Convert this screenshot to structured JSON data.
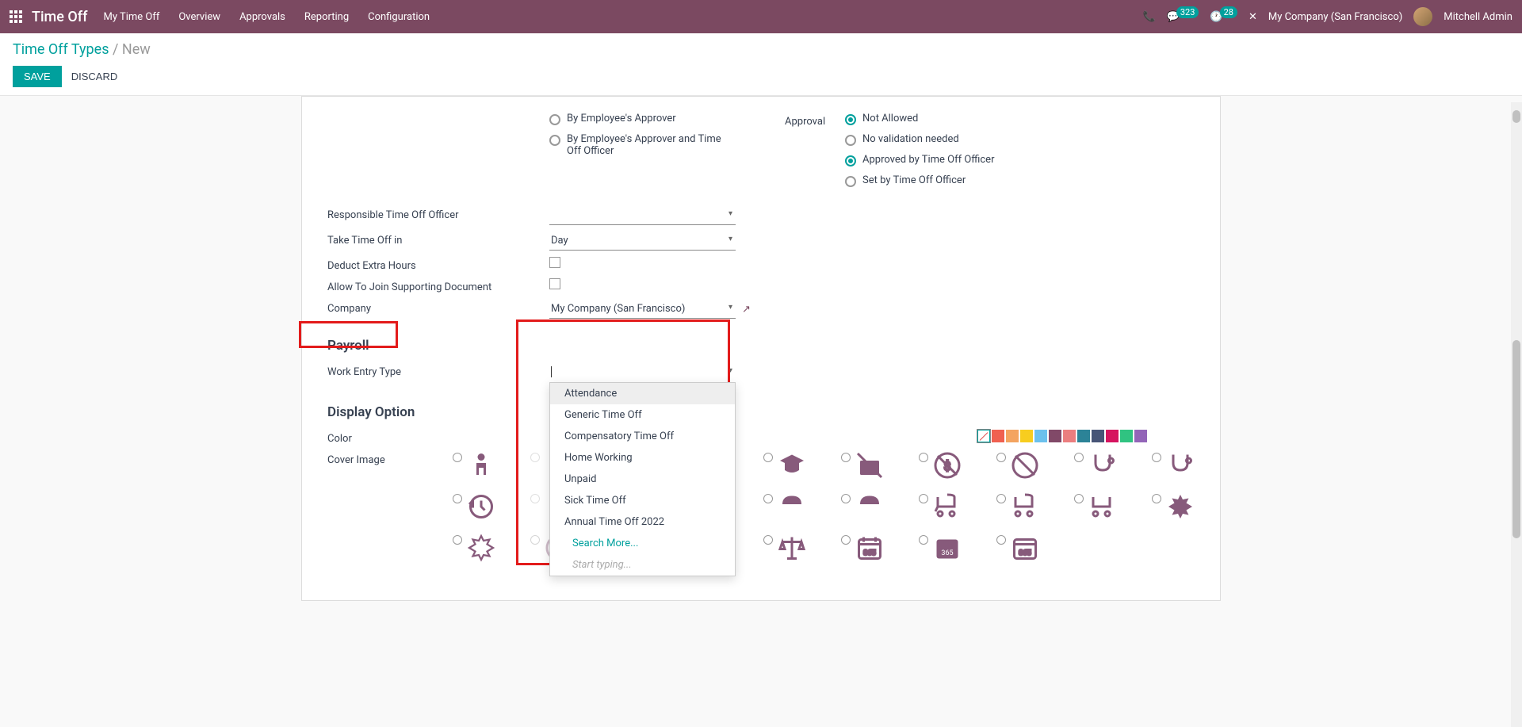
{
  "nav": {
    "app_title": "Time Off",
    "items": [
      "My Time Off",
      "Overview",
      "Approvals",
      "Reporting",
      "Configuration"
    ],
    "msg_count": "323",
    "activity_count": "28",
    "company": "My Company (San Francisco)",
    "user": "Mitchell Admin"
  },
  "breadcrumb": {
    "parent": "Time Off Types",
    "current": "New"
  },
  "actions": {
    "save": "SAVE",
    "discard": "DISCARD"
  },
  "form": {
    "left_radios": {
      "options": [
        "By Employee's Approver",
        "By Employee's Approver and Time Off Officer"
      ]
    },
    "approval": {
      "label": "Approval",
      "options": [
        "Not Allowed",
        "No validation needed",
        "Approved by Time Off Officer",
        "Set by Time Off Officer"
      ],
      "checked": [
        0,
        2
      ]
    },
    "responsible_label": "Responsible Time Off Officer",
    "take_label": "Take Time Off in",
    "take_value": "Day",
    "deduct_label": "Deduct Extra Hours",
    "supporting_label": "Allow To Join Supporting Document",
    "company_label": "Company",
    "company_value": "My Company (San Francisco)",
    "payroll_title": "Payroll",
    "work_entry_label": "Work Entry Type",
    "display_title": "Display Option",
    "color_label": "Color",
    "cover_label": "Cover Image"
  },
  "dropdown": {
    "items": [
      "Attendance",
      "Generic Time Off",
      "Compensatory Time Off",
      "Home Working",
      "Unpaid",
      "Sick Time Off",
      "Annual Time Off 2022"
    ],
    "search_more": "Search More...",
    "start_typing": "Start typing..."
  },
  "colors": [
    "#F06050",
    "#F4A460",
    "#F7CD1F",
    "#6CC1ED",
    "#814968",
    "#EB7E7F",
    "#2C8397",
    "#475577",
    "#D6145F",
    "#30C381",
    "#9365B8"
  ]
}
